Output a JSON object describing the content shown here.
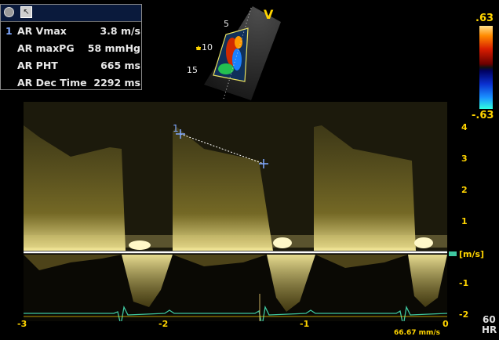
{
  "measurements": [
    {
      "idx": "1",
      "label": "AR Vmax",
      "value": "3.8 m/s"
    },
    {
      "idx": "",
      "label": "AR maxPG",
      "value": "58 mmHg"
    },
    {
      "idx": "",
      "label": "AR PHT",
      "value": "665 ms"
    },
    {
      "idx": "",
      "label": "AR Dec Time",
      "value": "2292 ms"
    }
  ],
  "sector": {
    "depth_ticks": [
      "5",
      "10",
      "15"
    ],
    "view_label": "V"
  },
  "color_bar": {
    "top": ".63",
    "bottom": "-.63"
  },
  "doppler": {
    "velocity_ticks": [
      "4",
      "3",
      "2",
      "1",
      "[m/s]",
      "-1",
      "-2"
    ],
    "time_ticks": [
      "-3",
      "-2",
      "-1",
      "0"
    ],
    "unit": "[m/s]",
    "caliper_label": "1",
    "heart_rate_value": "60",
    "heart_rate_label": "HR",
    "sweep_speed": "66.67 mm/s"
  },
  "colors": {
    "accent": "#ffd400",
    "caliper": "#7fa8ff",
    "ecg": "#3fc8a0"
  }
}
